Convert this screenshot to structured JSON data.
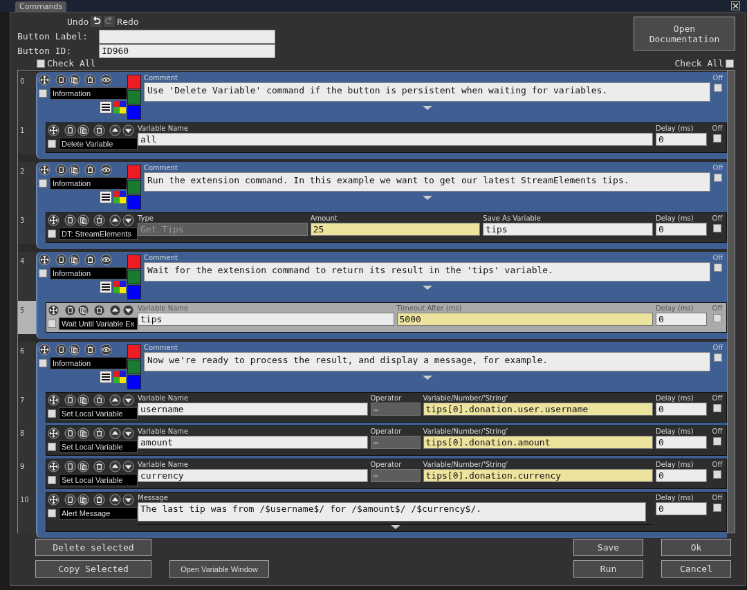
{
  "window": {
    "title": "Commands"
  },
  "history": {
    "undo": {
      "label": "Undo",
      "disabled": false
    },
    "redo": {
      "label": "Redo",
      "disabled": true
    }
  },
  "form": [
    {
      "label": "Button Label:"
    },
    {
      "label": "Button ID:",
      "value": "ID960"
    }
  ],
  "open_documentation": "Open Documentation",
  "check_all_left": {
    "label": "Check All",
    "checked": false
  },
  "check_all_right": {
    "label": "Check All",
    "checked": false
  },
  "groups": [
    {
      "index": "0",
      "kind": "comment",
      "type": "Information",
      "checked": false,
      "off": false,
      "off_label": "Off",
      "label": "Comment",
      "text": "Use 'Delete Variable' command if the button is persistent when waiting for variables.",
      "swatches": [
        {
          "color": "#ee1c24"
        },
        {
          "color": "#1b7a32"
        },
        {
          "color": "#0000ff"
        }
      ],
      "children": [
        {
          "index": "1",
          "kind": "action",
          "type": "Delete Variable",
          "checked": false,
          "selected": false,
          "off": false,
          "off_label": "Off",
          "fields": [
            {
              "kind": "text",
              "label": "Variable Name",
              "value": "all"
            }
          ],
          "delay": {
            "label": "Delay (ms)",
            "value": "0"
          }
        }
      ]
    },
    {
      "index": "2",
      "kind": "comment",
      "type": "Information",
      "checked": false,
      "off": false,
      "off_label": "Off",
      "label": "Comment",
      "text": "Run the extension command. In this example we want to get our latest StreamElements tips.",
      "swatches": [
        {
          "color": "#ee1c24"
        },
        {
          "color": "#1b7a32"
        },
        {
          "color": "#0000ff"
        }
      ],
      "children": [
        {
          "index": "3",
          "kind": "action",
          "type": "DT: StreamElements",
          "checked": false,
          "selected": false,
          "off": false,
          "off_label": "Off",
          "fields": [
            {
              "kind": "readonly",
              "label": "Type",
              "value": "Get Tips"
            },
            {
              "kind": "expression",
              "label": "Amount",
              "value": "25"
            },
            {
              "kind": "text",
              "label": "Save As Variable",
              "value": "tips"
            }
          ],
          "delay": {
            "label": "Delay (ms)",
            "value": "0"
          }
        }
      ]
    },
    {
      "index": "4",
      "kind": "comment",
      "type": "Information",
      "checked": false,
      "off": false,
      "off_label": "Off",
      "label": "Comment",
      "text": "Wait for the extension command to return its result in the 'tips' variable.",
      "swatches": [
        {
          "color": "#ee1c24"
        },
        {
          "color": "#1b7a32"
        },
        {
          "color": "#0000ff"
        }
      ],
      "children": [
        {
          "index": "5",
          "kind": "action",
          "type": "Wait Until Variable Ex",
          "checked": false,
          "selected": true,
          "off": false,
          "off_label": "Off",
          "fields": [
            {
              "kind": "text",
              "label": "Variable Name",
              "value": "tips"
            },
            {
              "kind": "expression",
              "label": "Timeout After (ms)",
              "value": "5000"
            }
          ],
          "delay": {
            "label": "Delay (ms)",
            "value": "0"
          }
        }
      ]
    },
    {
      "index": "6",
      "kind": "comment",
      "type": "Information",
      "checked": false,
      "off": false,
      "off_label": "Off",
      "label": "Comment",
      "text": "Now we're ready to process the result, and display a message, for example.",
      "swatches": [
        {
          "color": "#ee1c24"
        },
        {
          "color": "#1b7a32"
        },
        {
          "color": "#0000ff"
        }
      ],
      "children": [
        {
          "index": "7",
          "kind": "action",
          "type": "Set Local Variable",
          "checked": false,
          "selected": false,
          "off": false,
          "off_label": "Off",
          "fields": [
            {
              "kind": "text",
              "label": "Variable Name",
              "value": "username"
            },
            {
              "kind": "operator",
              "label": "Operator",
              "value": "="
            },
            {
              "kind": "expression",
              "label": "Variable/Number/'String'",
              "value": "tips[0].donation.user.username"
            }
          ],
          "delay": {
            "label": "Delay (ms)",
            "value": "0"
          }
        },
        {
          "index": "8",
          "kind": "action",
          "type": "Set Local Variable",
          "checked": false,
          "selected": false,
          "off": false,
          "off_label": "Off",
          "fields": [
            {
              "kind": "text",
              "label": "Variable Name",
              "value": "amount"
            },
            {
              "kind": "operator",
              "label": "Operator",
              "value": "="
            },
            {
              "kind": "expression",
              "label": "Variable/Number/'String'",
              "value": "tips[0].donation.amount"
            }
          ],
          "delay": {
            "label": "Delay (ms)",
            "value": "0"
          }
        },
        {
          "index": "9",
          "kind": "action",
          "type": "Set Local Variable",
          "checked": false,
          "selected": false,
          "off": false,
          "off_label": "Off",
          "fields": [
            {
              "kind": "text",
              "label": "Variable Name",
              "value": "currency"
            },
            {
              "kind": "operator",
              "label": "Operator",
              "value": "="
            },
            {
              "kind": "expression",
              "label": "Variable/Number/'String'",
              "value": "tips[0].donation.currency"
            }
          ],
          "delay": {
            "label": "Delay (ms)",
            "value": "0"
          }
        },
        {
          "index": "10",
          "kind": "action",
          "type": "Alert Message",
          "checked": false,
          "selected": false,
          "off": false,
          "off_label": "Off",
          "fields": [
            {
              "kind": "message",
              "label": "Message",
              "value": "The last tip was from /$username$/ for /$amount$/ /$currency$/."
            }
          ],
          "delay": {
            "label": "Delay (ms)",
            "value": "0"
          }
        }
      ]
    }
  ],
  "buttons": {
    "delete_selected": "Delete selected",
    "copy_selected": "Copy Selected",
    "open_variable_window": "Open Variable Window",
    "save": "Save",
    "run": "Run",
    "ok": "Ok",
    "cancel": "Cancel"
  }
}
